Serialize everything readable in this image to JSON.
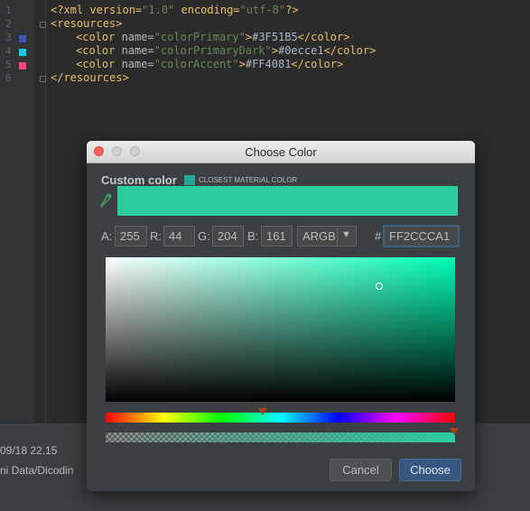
{
  "editor": {
    "line_numbers": [
      "1",
      "2",
      "3",
      "4",
      "5",
      "6"
    ],
    "swatch_colors": [
      "#3F51B5",
      "#0ecce1",
      "#FF4081"
    ],
    "line1": {
      "decl_open": "<?xml version=",
      "version": "\"1.0\"",
      "encoding_attr": " encoding=",
      "encoding": "\"utf-8\"",
      "decl_close": "?>"
    },
    "line2": "<resources>",
    "colors": [
      {
        "open": "<color ",
        "attr": "name=",
        "name": "\"colorPrimary\"",
        "close_open": ">",
        "value": "#3F51B5",
        "end": "</color>"
      },
      {
        "open": "<color ",
        "attr": "name=",
        "name": "\"colorPrimaryDark\"",
        "close_open": ">",
        "value": "#0ecce1",
        "end": "</color>"
      },
      {
        "open": "<color ",
        "attr": "name=",
        "name": "\"colorAccent\"",
        "close_open": ">",
        "value": "#FF4081",
        "end": "</color>"
      }
    ],
    "line6": "</resources>"
  },
  "bottom_panel": {
    "line1": "09/18 22.15",
    "line2": "ni Data/Dicodin"
  },
  "dialog": {
    "title": "Choose Color",
    "section_label": "Custom color",
    "closest_label": "CLOSEST MATERIAL COLOR",
    "closest_color": "#26a69a",
    "preview_color": "#2ccca1",
    "channels": {
      "a_label": "A:",
      "a_value": "255",
      "r_label": "R:",
      "r_value": "44",
      "g_label": "G:",
      "g_value": "204",
      "b_label": "B:",
      "b_value": "161"
    },
    "mode": "ARGB",
    "hash": "#",
    "hex": "FF2CCCA1",
    "hue_color": "#00fcb4",
    "cancel_label": "Cancel",
    "choose_label": "Choose",
    "icons": [
      "eyedropper-icon",
      "chevron-down-icon"
    ]
  }
}
